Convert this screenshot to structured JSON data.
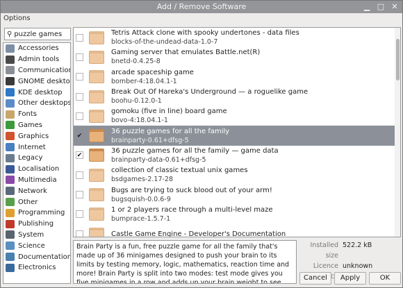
{
  "window": {
    "title": "Add / Remove Software"
  },
  "menubar": {
    "options": "Options"
  },
  "search": {
    "value": "puzzle games"
  },
  "categories": [
    {
      "label": "Accessories",
      "color": "#7c8fa6"
    },
    {
      "label": "Admin tools",
      "color": "#4a4a4a"
    },
    {
      "label": "Communication",
      "color": "#8a8f96"
    },
    {
      "label": "GNOME desktop",
      "color": "#3a3a3a"
    },
    {
      "label": "KDE desktop",
      "color": "#2e78c6"
    },
    {
      "label": "Other desktops",
      "color": "#5b8cc9"
    },
    {
      "label": "Fonts",
      "color": "#c9a66b"
    },
    {
      "label": "Games",
      "color": "#3c9a3c"
    },
    {
      "label": "Graphics",
      "color": "#d0542e"
    },
    {
      "label": "Internet",
      "color": "#4a7fc1"
    },
    {
      "label": "Legacy",
      "color": "#6a7c8e"
    },
    {
      "label": "Localisation",
      "color": "#3b5998"
    },
    {
      "label": "Multimedia",
      "color": "#8a4aa8"
    },
    {
      "label": "Network",
      "color": "#5a6a7a"
    },
    {
      "label": "Other",
      "color": "#5aa04a"
    },
    {
      "label": "Programming",
      "color": "#e0a030"
    },
    {
      "label": "Publishing",
      "color": "#c0392b"
    },
    {
      "label": "System",
      "color": "#5a6470"
    },
    {
      "label": "Science",
      "color": "#5a8fc0"
    },
    {
      "label": "Documentation",
      "color": "#4a7fb0"
    },
    {
      "label": "Electronics",
      "color": "#3a6a9a"
    }
  ],
  "packages": [
    {
      "title": "Tetris Attack clone with spooky undertones - data files",
      "name": "blocks-of-the-undead-data-1.0-7",
      "checked": false,
      "selected": false,
      "open": false
    },
    {
      "title": "Gaming server that emulates Battle.net(R)",
      "name": "bnetd-0.4.25-8",
      "checked": false,
      "selected": false,
      "open": false
    },
    {
      "title": "arcade spaceship game",
      "name": "bomber-4:18.04.1-1",
      "checked": false,
      "selected": false,
      "open": false
    },
    {
      "title": "Break Out Of Hareka's Underground — a roguelike game",
      "name": "boohu-0.12.0-1",
      "checked": false,
      "selected": false,
      "open": false
    },
    {
      "title": "gomoku (five in line) board game",
      "name": "bovo-4:18.04.1-1",
      "checked": false,
      "selected": false,
      "open": false
    },
    {
      "title": "36 puzzle games for all the family",
      "name": "brainparty-0.61+dfsg-5",
      "checked": true,
      "selected": true,
      "open": true
    },
    {
      "title": "36 puzzle games for all the family — game data",
      "name": "brainparty-data-0.61+dfsg-5",
      "checked": true,
      "selected": false,
      "open": true
    },
    {
      "title": "collection of classic textual unix games",
      "name": "bsdgames-2.17-28",
      "checked": false,
      "selected": false,
      "open": false
    },
    {
      "title": "Bugs are trying to suck blood out of your arm!",
      "name": "bugsquish-0.0.6-9",
      "checked": false,
      "selected": false,
      "open": false
    },
    {
      "title": "1 or 2 players race through a multi-level maze",
      "name": "bumprace-1.5.7-1",
      "checked": false,
      "selected": false,
      "open": false
    },
    {
      "title": "Castle Game Engine - Developer's Documentation",
      "name": "",
      "checked": false,
      "selected": false,
      "open": false
    }
  ],
  "description": "Brain Party is a fun, free puzzle game for all the family that's made up of 36 minigames designed to push your brain to its limits by testing memory, logic, mathematics, reaction time and more! Brain Party is split into two modes: test mode gives you five minigames in a row and adds up your brain weight to see how smart you are, and practise mode lets you play your favourite minigames",
  "info": {
    "installed_size_label": "Installed size",
    "installed_size": "522.2 kB",
    "licence_label": "Licence",
    "licence": "unknown",
    "source_label": "Source",
    "source": ""
  },
  "buttons": {
    "cancel": "Cancel",
    "apply": "Apply",
    "ok": "OK"
  }
}
